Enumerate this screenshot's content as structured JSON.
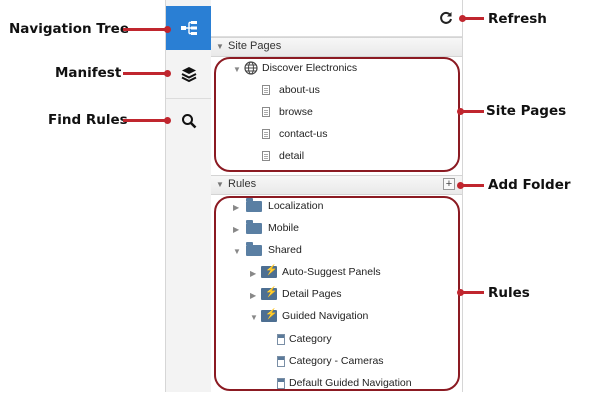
{
  "callouts": {
    "navigation_tree": "Navigation Tree",
    "manifest": "Manifest",
    "find_rules": "Find Rules",
    "refresh": "Refresh",
    "site_pages": "Site Pages",
    "add_folder": "Add Folder",
    "rules": "Rules"
  },
  "panel": {
    "site_pages_header": "Site Pages",
    "site_root": "Discover Electronics",
    "pages": [
      "about-us",
      "browse",
      "contact-us",
      "detail"
    ],
    "rules_header": "Rules",
    "folders": [
      "Localization",
      "Mobile",
      "Shared"
    ],
    "shared_children": [
      "Auto-Suggest Panels",
      "Detail Pages",
      "Guided Navigation"
    ],
    "guided_nav_rules": [
      "Category",
      "Category - Cameras",
      "Default Guided Navigation"
    ]
  },
  "colors": {
    "accent": "#2a7fd4",
    "callout_line": "#c0262e",
    "outline": "#8b1a22"
  },
  "icons": {
    "nav_tree": "sitemap-icon",
    "manifest": "layers-icon",
    "find": "search-icon",
    "refresh": "refresh-icon",
    "add": "plus-icon",
    "globe": "globe-icon"
  }
}
